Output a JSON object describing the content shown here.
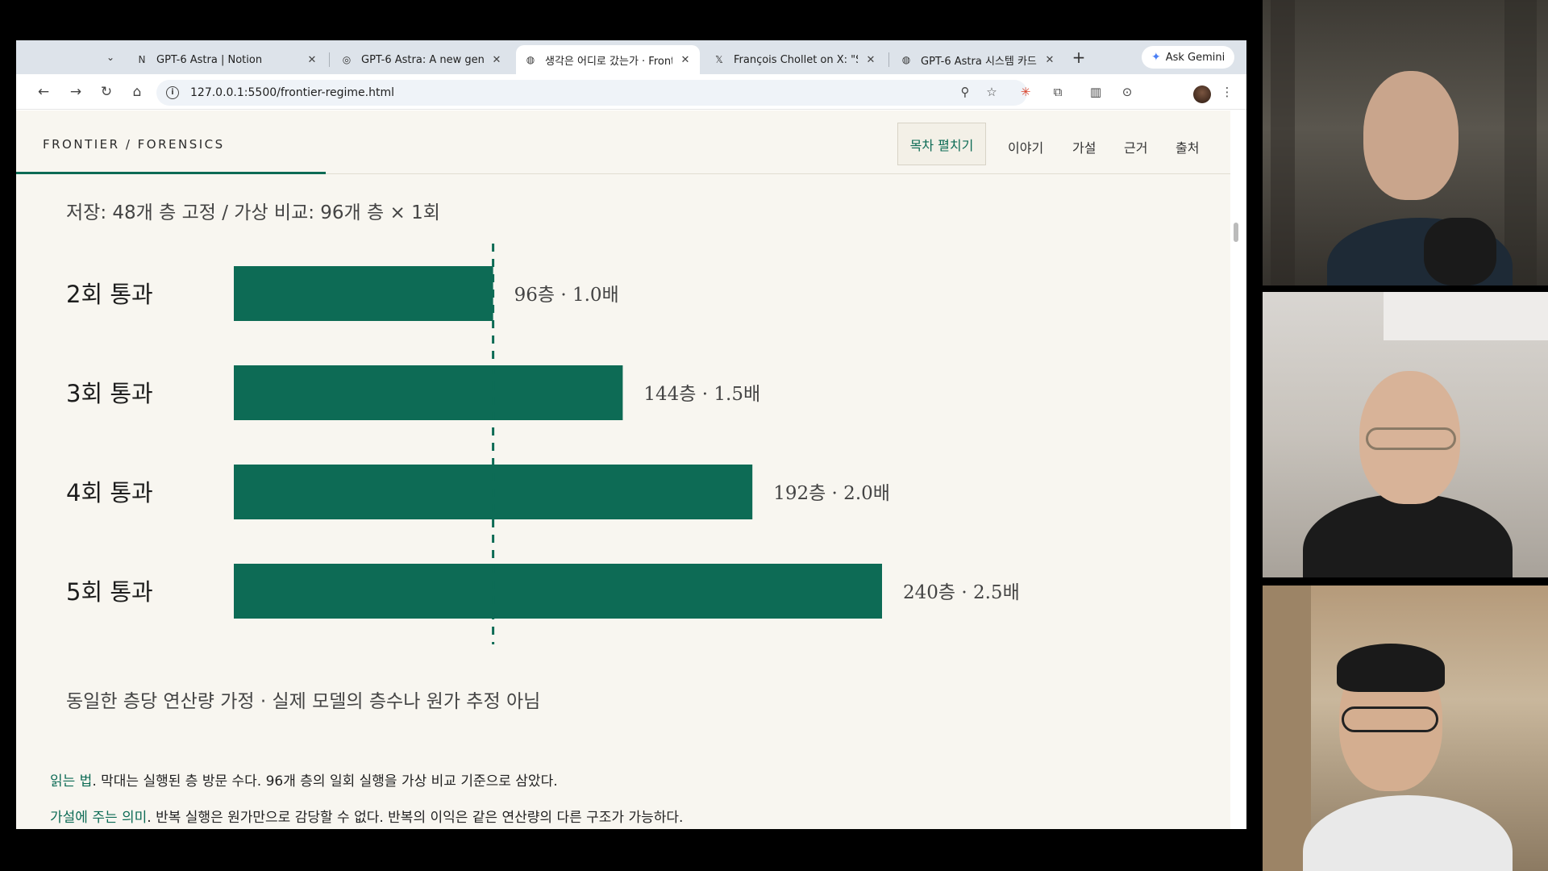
{
  "browser": {
    "tabs": [
      {
        "title": "GPT-6 Astra | Notion",
        "favicon": "notion-icon",
        "glyph": "N"
      },
      {
        "title": "GPT-6 Astra: A new gen",
        "favicon": "globe-icon",
        "glyph": "◎"
      },
      {
        "title": "생각은 어디로 갔는가 · Front",
        "favicon": "globe-icon",
        "glyph": "◍",
        "active": true
      },
      {
        "title": "François Chollet on X: \"S",
        "favicon": "x-icon",
        "glyph": "𝕏"
      },
      {
        "title": "GPT-6 Astra 시스템 카드 –",
        "favicon": "globe-icon",
        "glyph": "◍"
      }
    ],
    "ask_gemini": "Ask Gemini",
    "url": "127.0.0.1:5500/frontier-regime.html"
  },
  "header": {
    "brand": "FRONTIER / FORENSICS",
    "toc_button": "목차 펼치기",
    "nav": [
      "이야기",
      "가설",
      "근거",
      "출처"
    ]
  },
  "content": {
    "subtitle": "저장: 48개 층 고정 / 가상 비교: 96개 층 × 1회",
    "footnote": "동일한 층당 연산량 가정 · 실제 모델의 층수나 원가 추정 아님",
    "read_label": "읽는 법",
    "read_text": ". 막대는 실행된 층 방문 수다. 96개 층의 일회 실행을 가상 비교 기준으로 삼았다.",
    "cut_label": "가설에 주는 의미",
    "cut_text": ". 반복 실행은 원가만으로 감당할 수 없다. 반복의 이익은 같은 연산량의 다른 구조가 가능하다."
  },
  "chart_data": {
    "type": "bar",
    "orientation": "horizontal",
    "categories": [
      "2회 통과",
      "3회 통과",
      "4회 통과",
      "5회 통과"
    ],
    "values": [
      96,
      144,
      192,
      240
    ],
    "value_labels": [
      "96층 · 1.0배",
      "144층 · 1.5배",
      "192층 · 2.0배",
      "240층 · 2.5배"
    ],
    "reference_value": 96,
    "reference_style": "dashed",
    "xlim": [
      0,
      240
    ],
    "bar_color": "#0d6b55",
    "grid": false
  },
  "colors": {
    "accent": "#0d6b55",
    "page_bg": "#f8f6f0"
  }
}
